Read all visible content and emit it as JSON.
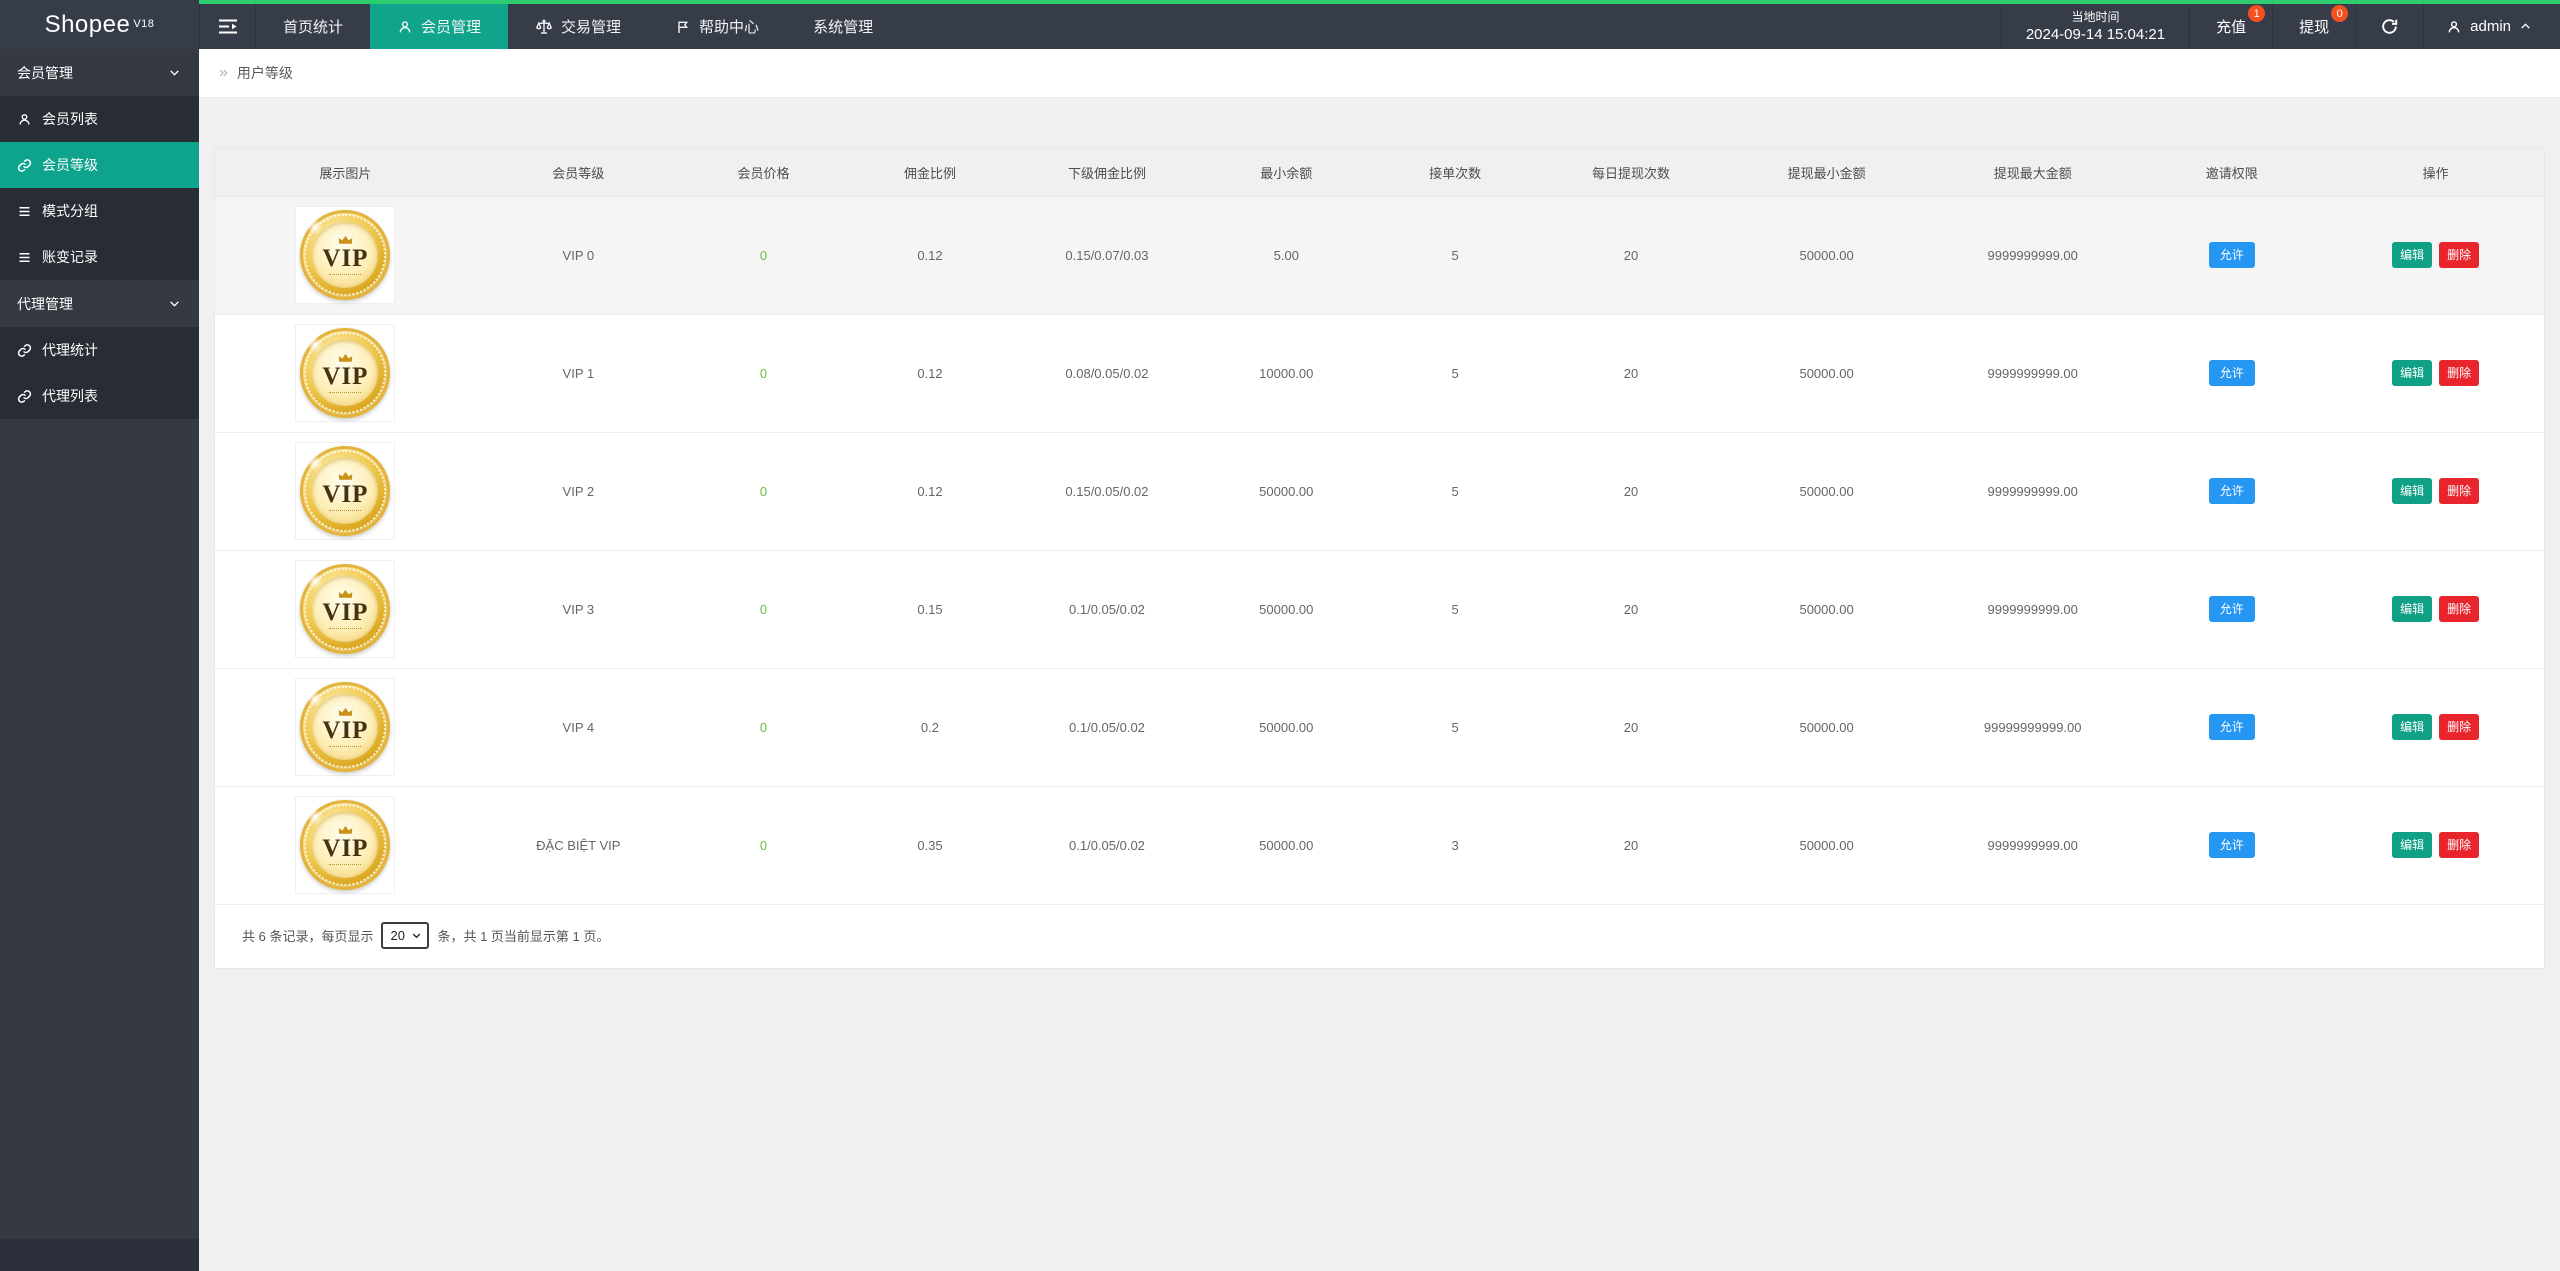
{
  "topbar": {
    "logo": "Shopee",
    "logo_version": "V18",
    "nav_items": [
      {
        "label": "首页统计"
      },
      {
        "label": "会员管理"
      },
      {
        "label": "交易管理"
      },
      {
        "label": "帮助中心"
      },
      {
        "label": "系统管理"
      }
    ],
    "local_time_label": "当地时间",
    "local_time_value": "2024-09-14 15:04:21",
    "recharge_label": "充值",
    "recharge_badge": "1",
    "withdraw_label": "提现",
    "withdraw_badge": "0",
    "username": "admin"
  },
  "sidebar": {
    "section1_label": "会员管理",
    "section1_items": [
      {
        "label": "会员列表"
      },
      {
        "label": "会员等级"
      },
      {
        "label": "模式分组"
      },
      {
        "label": "账变记录"
      }
    ],
    "section2_label": "代理管理",
    "section2_items": [
      {
        "label": "代理统计"
      },
      {
        "label": "代理列表"
      }
    ]
  },
  "breadcrumb": {
    "title": "用户等级"
  },
  "table": {
    "columns": [
      "展示图片",
      "会员等级",
      "会员价格",
      "佣金比例",
      "下级佣金比例",
      "最小余额",
      "接单次数",
      "每日提现次数",
      "提现最小金额",
      "提现最大金额",
      "邀请权限",
      "操作"
    ],
    "coin_text": "VIP",
    "action_allow": "允许",
    "action_edit": "编辑",
    "action_delete": "删除",
    "rows": [
      {
        "level": "VIP 0",
        "price": "0",
        "commission_rate": "0.12",
        "sub_commission_rate": "0.15/0.07/0.03",
        "min_balance": "5.00",
        "order_count": "5",
        "daily_withdraw_count": "20",
        "withdraw_min": "50000.00",
        "withdraw_max": "9999999999.00"
      },
      {
        "level": "VIP 1",
        "price": "0",
        "commission_rate": "0.12",
        "sub_commission_rate": "0.08/0.05/0.02",
        "min_balance": "10000.00",
        "order_count": "5",
        "daily_withdraw_count": "20",
        "withdraw_min": "50000.00",
        "withdraw_max": "9999999999.00"
      },
      {
        "level": "VIP 2",
        "price": "0",
        "commission_rate": "0.12",
        "sub_commission_rate": "0.15/0.05/0.02",
        "min_balance": "50000.00",
        "order_count": "5",
        "daily_withdraw_count": "20",
        "withdraw_min": "50000.00",
        "withdraw_max": "9999999999.00"
      },
      {
        "level": "VIP 3",
        "price": "0",
        "commission_rate": "0.15",
        "sub_commission_rate": "0.1/0.05/0.02",
        "min_balance": "50000.00",
        "order_count": "5",
        "daily_withdraw_count": "20",
        "withdraw_min": "50000.00",
        "withdraw_max": "9999999999.00"
      },
      {
        "level": "VIP 4",
        "price": "0",
        "commission_rate": "0.2",
        "sub_commission_rate": "0.1/0.05/0.02",
        "min_balance": "50000.00",
        "order_count": "5",
        "daily_withdraw_count": "20",
        "withdraw_min": "50000.00",
        "withdraw_max": "99999999999.00"
      },
      {
        "level": "ĐẶC BIỆT VIP",
        "price": "0",
        "commission_rate": "0.35",
        "sub_commission_rate": "0.1/0.05/0.02",
        "min_balance": "50000.00",
        "order_count": "3",
        "daily_withdraw_count": "20",
        "withdraw_min": "50000.00",
        "withdraw_max": "9999999999.00"
      }
    ]
  },
  "pagination": {
    "total_prefix": "共 6 条记录，每页显示",
    "per_page": "20",
    "total_suffix": "条，共 1 页当前显示第 1 页。"
  }
}
